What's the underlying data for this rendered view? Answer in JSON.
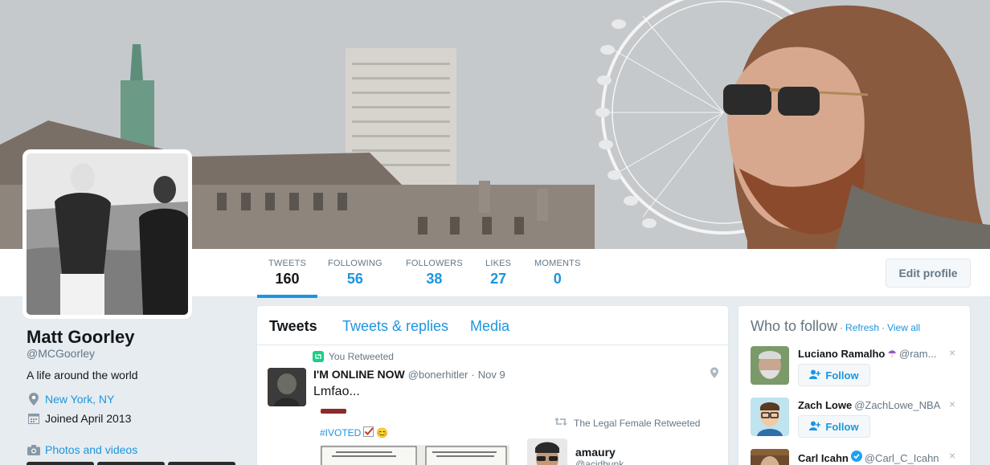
{
  "profile": {
    "name": "Matt Goorley",
    "handle": "@MCGoorley",
    "bio": "A life around the world",
    "location": "New York, NY",
    "joined": "Joined April 2013",
    "photos_label": "Photos and videos"
  },
  "nav": {
    "stats": [
      {
        "label": "TWEETS",
        "value": "160"
      },
      {
        "label": "FOLLOWING",
        "value": "56"
      },
      {
        "label": "FOLLOWERS",
        "value": "38"
      },
      {
        "label": "LIKES",
        "value": "27"
      },
      {
        "label": "MOMENTS",
        "value": "0"
      }
    ],
    "edit_profile": "Edit profile"
  },
  "timeline": {
    "tabs": [
      "Tweets",
      "Tweets & replies",
      "Media"
    ],
    "tweet": {
      "retweet_context": "You Retweeted",
      "author": "I'M ONLINE NOW",
      "handle": "@bonerhitler",
      "separator": "·",
      "date": "Nov 9",
      "text": "Lmfao...",
      "embedded_retweet_context": "The Legal Female Retweeted",
      "hashtag": "#IVOTED",
      "hashtag_emoji": "😊",
      "embedded_author": "amaury",
      "embedded_handle": "@acidbunk"
    }
  },
  "who_to_follow": {
    "title": "Who to follow",
    "refresh": "Refresh",
    "view_all": "View all",
    "dot": "·",
    "follow_label": "Follow",
    "close": "×",
    "users": [
      {
        "name": "Luciano Ramalho",
        "badge": "☂",
        "handle": "@ram..."
      },
      {
        "name": "Zach Lowe",
        "handle": "@ZachLowe_NBA"
      },
      {
        "name": "Carl Icahn",
        "verified": true,
        "handle": "@Carl_C_Icahn"
      }
    ]
  },
  "colors": {
    "accent": "#1b95e0",
    "retweet_green": "#19cf86",
    "muted": "#657786"
  }
}
